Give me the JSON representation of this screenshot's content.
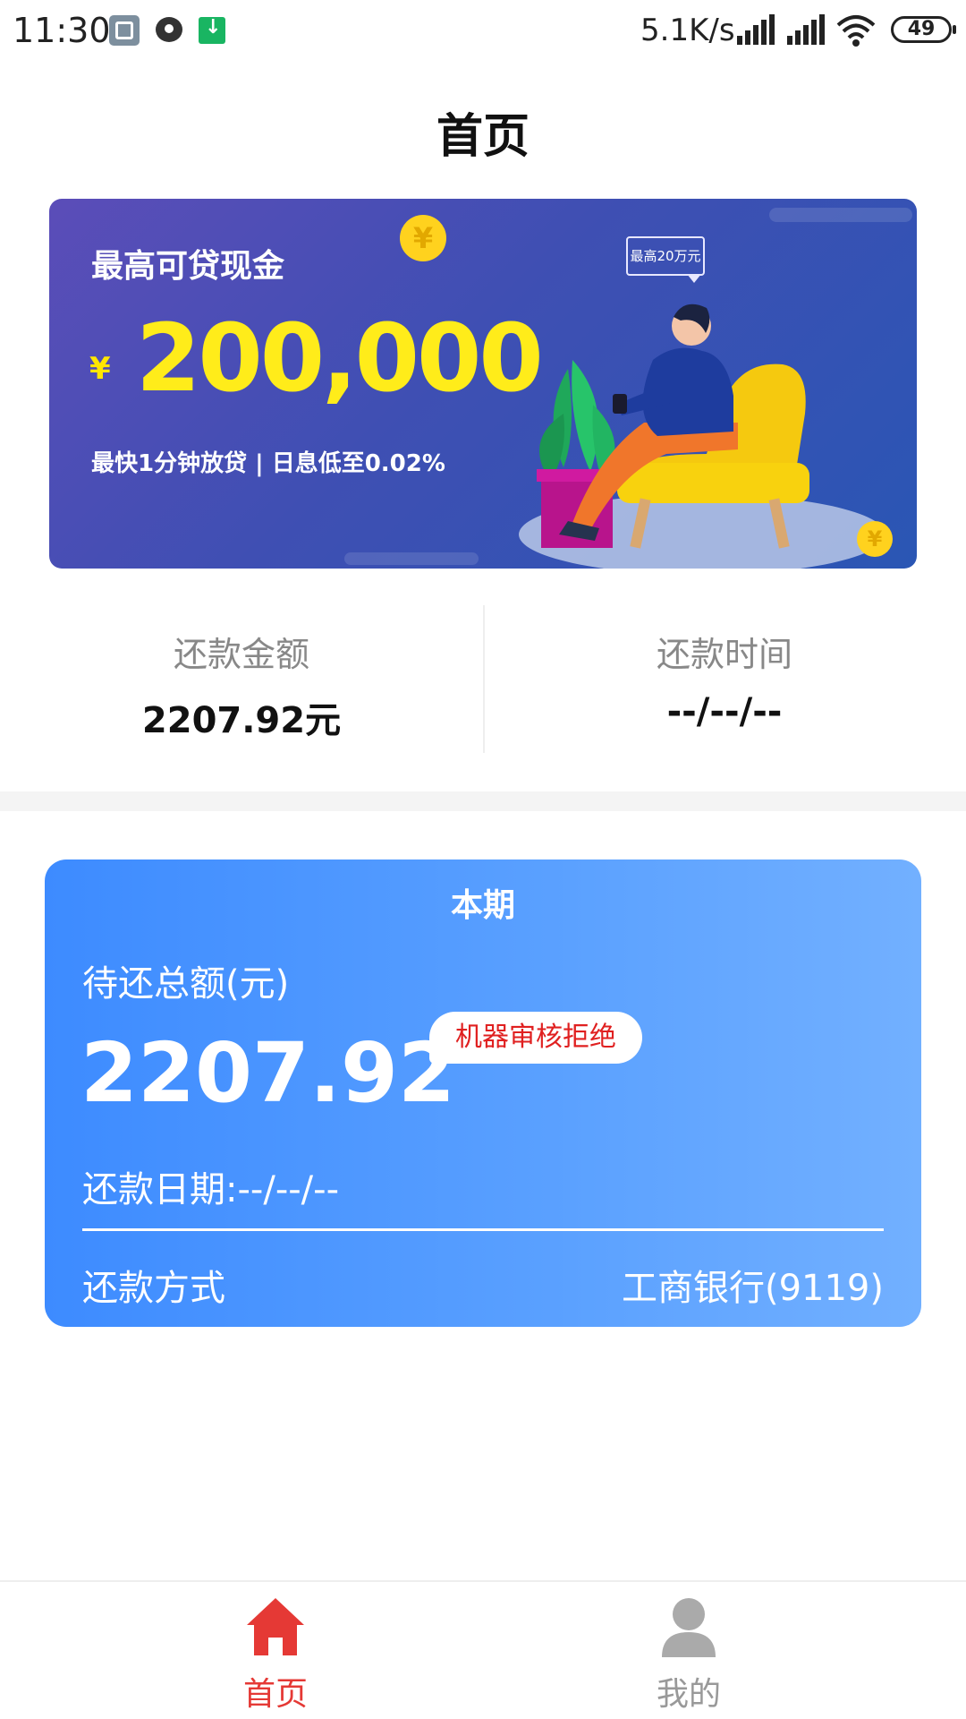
{
  "status_bar": {
    "time": "11:30",
    "net_speed": "5.1K/s",
    "battery": "49",
    "icons": [
      "gallery-icon",
      "chat-icon",
      "download-icon",
      "signal-icon",
      "hd-signal-icon",
      "wifi-icon",
      "battery-icon"
    ]
  },
  "page": {
    "title": "首页"
  },
  "banner": {
    "headline": "最高可贷现金",
    "currency": "¥",
    "amount": "200,000",
    "subline": "最快1分钟放贷 | 日息低至0.02%",
    "bubble": "最高20万元",
    "coin_symbol": "¥"
  },
  "summary": {
    "repay_amount_label": "还款金额",
    "repay_amount_value": "2207.92元",
    "repay_time_label": "还款时间",
    "repay_time_value": "--/--/--"
  },
  "period_card": {
    "title": "本期",
    "total_label": "待还总额(元)",
    "total_amount": "2207.92",
    "status_badge": "机器审核拒绝",
    "date_text": "还款日期:--/--/--",
    "method_label": "还款方式",
    "method_value": "工商银行(9119)"
  },
  "bottom_nav": {
    "items": [
      {
        "label": "首页",
        "icon": "home-icon",
        "active": true
      },
      {
        "label": "我的",
        "icon": "user-icon",
        "active": false
      }
    ]
  },
  "colors": {
    "accent_red": "#e53935",
    "card_blue": "#3d8bff",
    "banner_yellow": "#ffec1a",
    "inactive_gray": "#999999"
  }
}
